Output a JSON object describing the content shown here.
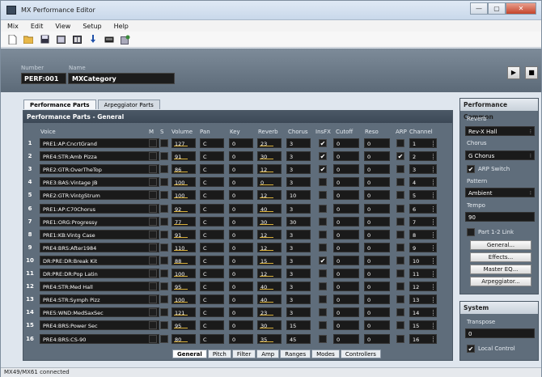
{
  "window": {
    "title": "MX Performance Editor",
    "min": "—",
    "max": "▢",
    "close": "✕"
  },
  "menu": [
    "Mix",
    "Edit",
    "View",
    "Setup",
    "Help"
  ],
  "toolbar": [
    "new-icon",
    "open-icon",
    "save-icon",
    "grid-icon",
    "panel-icon",
    "download-icon",
    "keyboard-icon",
    "wizard-icon"
  ],
  "header": {
    "number_label": "Number",
    "name_label": "Name",
    "number": "PERF:001",
    "name": "MXCategory",
    "play": "▶",
    "stop": "■"
  },
  "tabs": {
    "parts": "Performance Parts",
    "arp": "Arpeggiator Parts"
  },
  "panel": {
    "title": "Performance Parts - General"
  },
  "columns": {
    "voice": "Voice",
    "m": "M",
    "s": "S",
    "volume": "Volume",
    "pan": "Pan",
    "key": "Key",
    "reverb": "Reverb",
    "chorus": "Chorus",
    "insfx": "InsFX",
    "cutoff": "Cutoff",
    "reso": "Reso",
    "arp": "ARP",
    "channel": "Channel"
  },
  "parts": [
    {
      "n": "1",
      "voice": "PRE1:AP:CncrtGrand",
      "volume": "127",
      "pan": "C",
      "key": "0",
      "reverb": "23",
      "chorus": "3",
      "insfx": true,
      "cutoff": "0",
      "reso": "0",
      "arp": false,
      "channel": "1"
    },
    {
      "n": "2",
      "voice": "PRE4:STR:Amb Pizza",
      "volume": "91",
      "pan": "C",
      "key": "0",
      "reverb": "30",
      "chorus": "3",
      "insfx": true,
      "cutoff": "0",
      "reso": "0",
      "arp": true,
      "channel": "2"
    },
    {
      "n": "3",
      "voice": "PRE2:GTR:OverTheTop",
      "volume": "86",
      "pan": "C",
      "key": "0",
      "reverb": "12",
      "chorus": "3",
      "insfx": true,
      "cutoff": "0",
      "reso": "0",
      "arp": false,
      "channel": "3"
    },
    {
      "n": "4",
      "voice": "PRE3:BAS:Vintage JB",
      "volume": "100",
      "pan": "C",
      "key": "0",
      "reverb": "0",
      "chorus": "3",
      "insfx": false,
      "cutoff": "0",
      "reso": "0",
      "arp": false,
      "channel": "4"
    },
    {
      "n": "5",
      "voice": "PRE2:GTR:VintgStrum",
      "volume": "100",
      "pan": "C",
      "key": "0",
      "reverb": "12",
      "chorus": "10",
      "insfx": false,
      "cutoff": "0",
      "reso": "0",
      "arp": false,
      "channel": "5"
    },
    {
      "n": "6",
      "voice": "PRE1:AP:C70Chorus",
      "volume": "92",
      "pan": "C",
      "key": "0",
      "reverb": "40",
      "chorus": "3",
      "insfx": false,
      "cutoff": "0",
      "reso": "0",
      "arp": false,
      "channel": "6"
    },
    {
      "n": "7",
      "voice": "PRE1:ORG:Progressy",
      "volume": "77",
      "pan": "C",
      "key": "0",
      "reverb": "30",
      "chorus": "30",
      "insfx": false,
      "cutoff": "0",
      "reso": "0",
      "arp": false,
      "channel": "7"
    },
    {
      "n": "8",
      "voice": "PRE1:KB:Vintg Case",
      "volume": "91",
      "pan": "C",
      "key": "0",
      "reverb": "12",
      "chorus": "3",
      "insfx": false,
      "cutoff": "0",
      "reso": "0",
      "arp": false,
      "channel": "8"
    },
    {
      "n": "9",
      "voice": "PRE4:BRS:After1984",
      "volume": "110",
      "pan": "C",
      "key": "0",
      "reverb": "12",
      "chorus": "3",
      "insfx": false,
      "cutoff": "0",
      "reso": "0",
      "arp": false,
      "channel": "9"
    },
    {
      "n": "10",
      "voice": "DR:PRE:DR:Break Kit",
      "volume": "88",
      "pan": "C",
      "key": "0",
      "reverb": "15",
      "chorus": "3",
      "insfx": true,
      "cutoff": "0",
      "reso": "0",
      "arp": false,
      "channel": "10"
    },
    {
      "n": "11",
      "voice": "DR:PRE:DR:Pop Latin",
      "volume": "100",
      "pan": "C",
      "key": "0",
      "reverb": "12",
      "chorus": "3",
      "insfx": false,
      "cutoff": "0",
      "reso": "0",
      "arp": false,
      "channel": "11"
    },
    {
      "n": "12",
      "voice": "PRE4:STR:Med Hall",
      "volume": "95",
      "pan": "C",
      "key": "0",
      "reverb": "40",
      "chorus": "3",
      "insfx": false,
      "cutoff": "0",
      "reso": "0",
      "arp": false,
      "channel": "12"
    },
    {
      "n": "13",
      "voice": "PRE4:STR:Symph Pizz",
      "volume": "100",
      "pan": "C",
      "key": "0",
      "reverb": "40",
      "chorus": "3",
      "insfx": false,
      "cutoff": "0",
      "reso": "0",
      "arp": false,
      "channel": "13"
    },
    {
      "n": "14",
      "voice": "PRE5:WND:MedSaxSec",
      "volume": "121",
      "pan": "C",
      "key": "0",
      "reverb": "23",
      "chorus": "3",
      "insfx": false,
      "cutoff": "0",
      "reso": "0",
      "arp": false,
      "channel": "14"
    },
    {
      "n": "15",
      "voice": "PRE4:BRS:Power Sec",
      "volume": "95",
      "pan": "C",
      "key": "0",
      "reverb": "30",
      "chorus": "15",
      "insfx": false,
      "cutoff": "0",
      "reso": "0",
      "arp": false,
      "channel": "15"
    },
    {
      "n": "16",
      "voice": "PRE4:BRS:CS-90",
      "volume": "80",
      "pan": "C",
      "key": "0",
      "reverb": "35",
      "chorus": "45",
      "insfx": false,
      "cutoff": "0",
      "reso": "0",
      "arp": false,
      "channel": "16"
    }
  ],
  "subtabs": [
    "General",
    "Pitch",
    "Filter",
    "Amp",
    "Ranges",
    "Modes",
    "Controllers"
  ],
  "common": {
    "title": "Performance Common",
    "reverb_label": "Reverb",
    "reverb": "Rev-X Hall",
    "chorus_label": "Chorus",
    "chorus": "G Chorus",
    "arp_switch": "ARP Switch",
    "pattern_label": "Pattern",
    "pattern": "Ambient",
    "tempo_label": "Tempo",
    "tempo": "90",
    "part_link": "Part 1-2 Link",
    "btn_general": "General...",
    "btn_effects": "Effects...",
    "btn_eq": "Master EQ...",
    "btn_arp": "Arpeggiator..."
  },
  "system": {
    "title": "System",
    "transpose_label": "Transpose",
    "transpose": "0",
    "local_control": "Local Control"
  },
  "status": "MX49/MX61 connected",
  "colors": {
    "panel": "#5f6d7b",
    "field": "#1a1a1a",
    "accent": "#d9b03a"
  }
}
